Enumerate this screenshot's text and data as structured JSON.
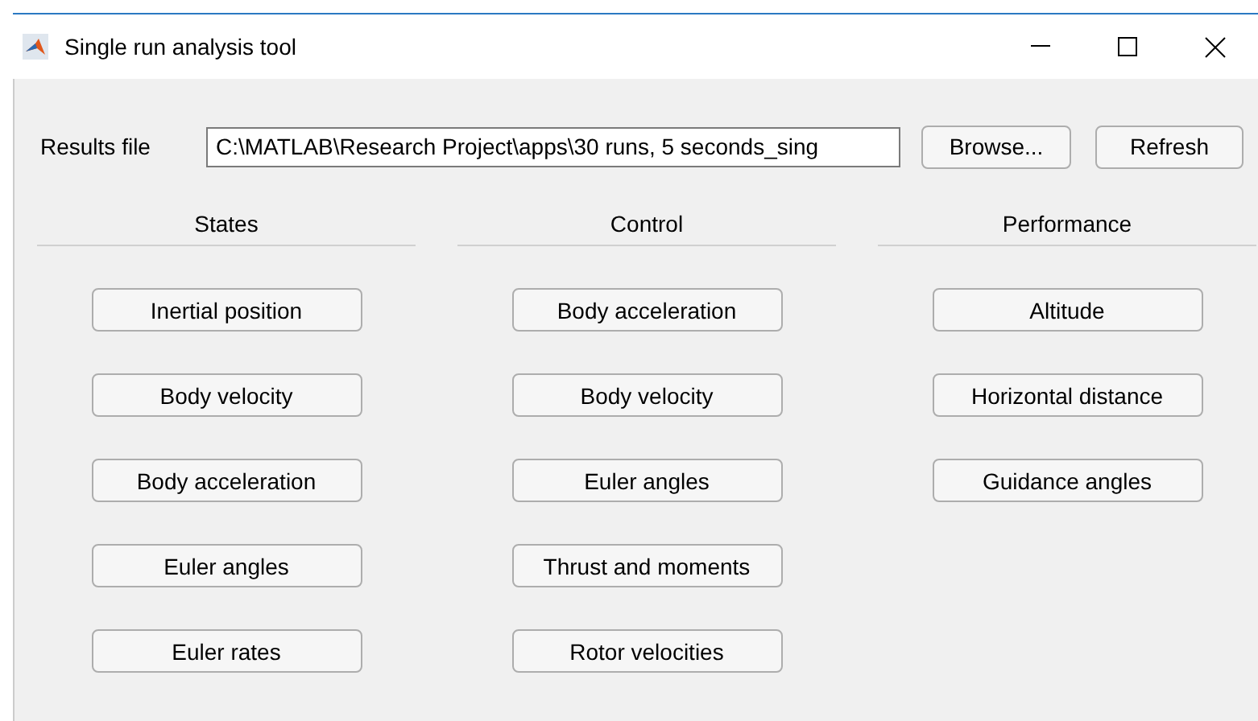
{
  "window": {
    "title": "Single run analysis tool"
  },
  "results_file": {
    "label": "Results file",
    "value": "C:\\MATLAB\\Research Project\\apps\\30 runs, 5 seconds_sing"
  },
  "buttons": [
    "Browse...",
    "Refresh"
  ],
  "sections": [
    {
      "title": "States",
      "buttons": [
        "Inertial position",
        "Body velocity",
        "Body acceleration",
        "Euler angles",
        "Euler rates"
      ]
    },
    {
      "title": "Control",
      "buttons": [
        "Body acceleration",
        "Body velocity",
        "Euler angles",
        "Thrust and moments",
        "Rotor velocities"
      ]
    },
    {
      "title": "Performance",
      "buttons": [
        "Altitude",
        "Horizontal distance",
        "Guidance angles"
      ]
    }
  ]
}
